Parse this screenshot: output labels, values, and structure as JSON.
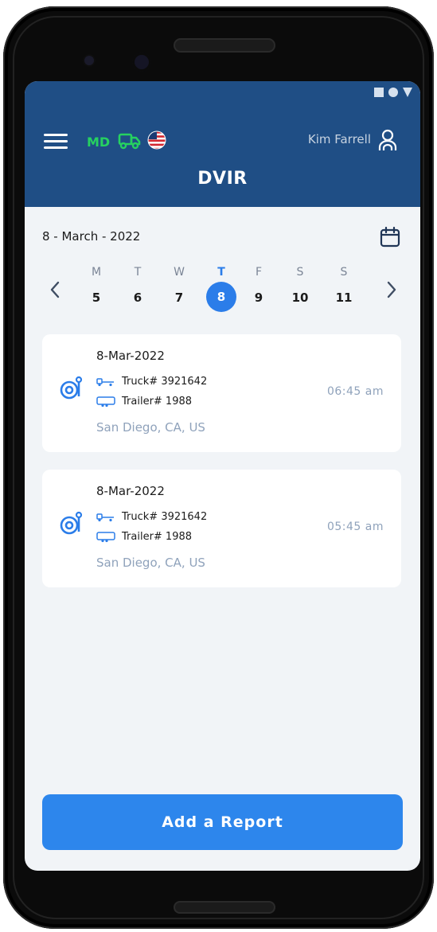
{
  "header": {
    "badge": "MD",
    "user_name": "Kim Farrell",
    "title": "DVIR"
  },
  "calendar": {
    "date_label": "8 - March - 2022",
    "days": [
      {
        "letter": "M",
        "num": "5"
      },
      {
        "letter": "T",
        "num": "6"
      },
      {
        "letter": "W",
        "num": "7"
      },
      {
        "letter": "T",
        "num": "8"
      },
      {
        "letter": "F",
        "num": "9"
      },
      {
        "letter": "S",
        "num": "10"
      },
      {
        "letter": "S",
        "num": "11"
      }
    ],
    "selected_index": 3
  },
  "reports": [
    {
      "date": "8-Mar-2022",
      "truck": "Truck# 3921642",
      "trailer": "Trailer# 1988",
      "location": "San Diego, CA, US",
      "time": "06:45 am"
    },
    {
      "date": "8-Mar-2022",
      "truck": "Truck# 3921642",
      "trailer": "Trailer# 1988",
      "location": "San Diego, CA, US",
      "time": "05:45 am"
    }
  ],
  "actions": {
    "add_report": "Add a Report"
  },
  "icons": [
    "menu-icon",
    "truck-icon",
    "us-flag-icon",
    "user-icon",
    "calendar-icon",
    "chevron-left-icon",
    "chevron-right-icon",
    "steering-wheel-icon",
    "truck-small-icon",
    "trailer-icon"
  ],
  "colors": {
    "header_bg": "#1f4e85",
    "accent": "#2d86ec",
    "badge_green": "#26d160",
    "screen_bg": "#f1f4f7"
  }
}
